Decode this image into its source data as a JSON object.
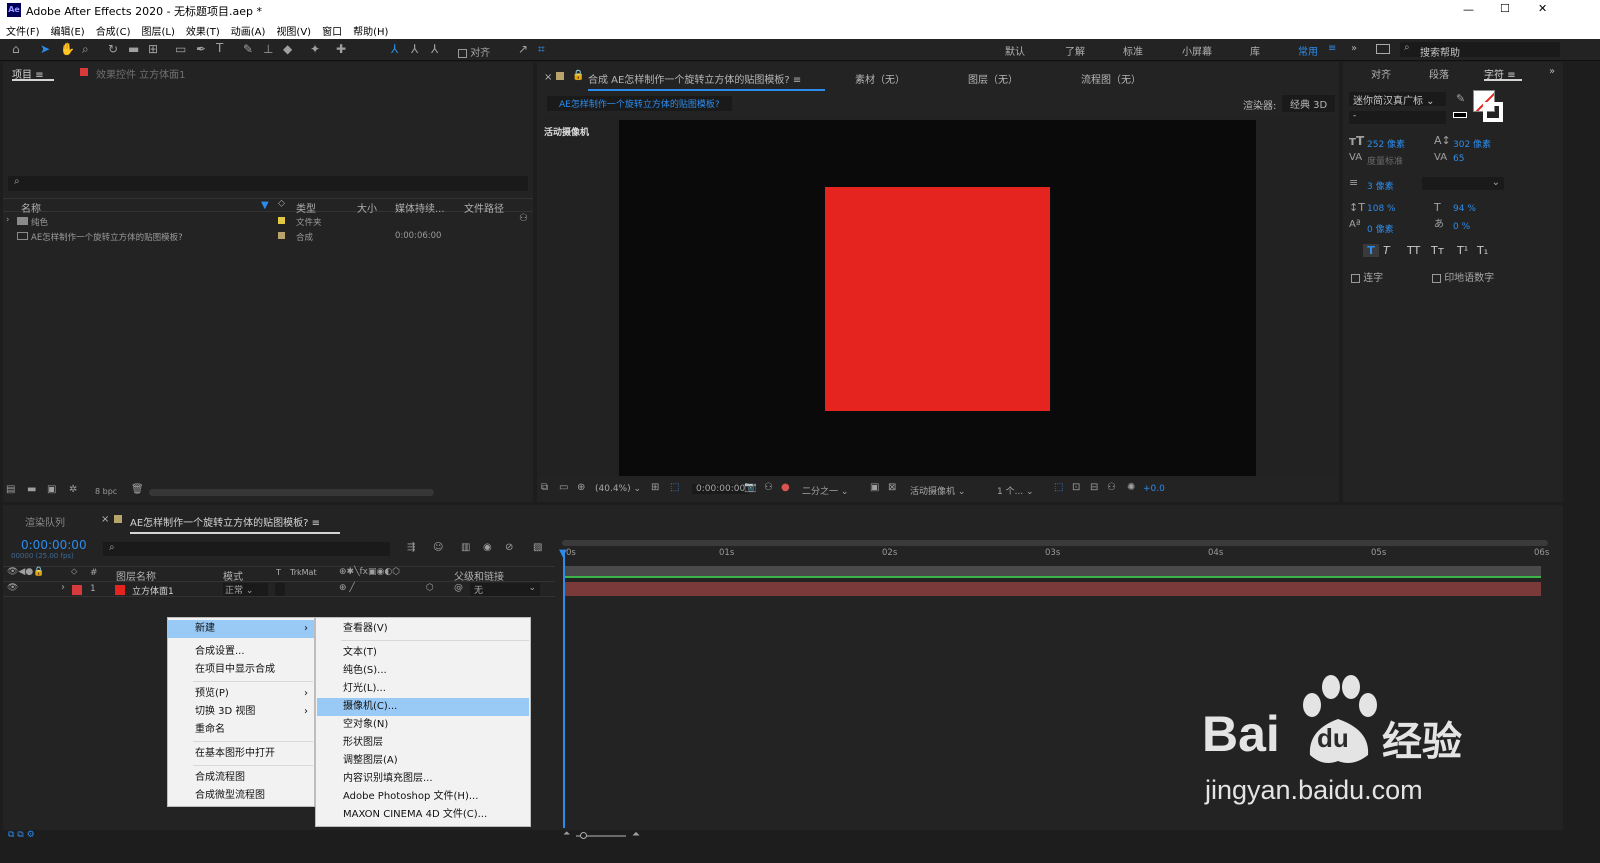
{
  "window": {
    "app_icon": "Ae",
    "title": "Adobe After Effects 2020 - 无标题项目.aep *",
    "minimize": "—",
    "maximize": "☐",
    "close": "✕"
  },
  "menu": [
    "文件(F)",
    "编辑(E)",
    "合成(C)",
    "图层(L)",
    "效果(T)",
    "动画(A)",
    "视图(V)",
    "窗口",
    "帮助(H)"
  ],
  "toolbar": {
    "align_label": "对齐",
    "workspaces": [
      "默认",
      "了解",
      "标准",
      "小屏幕",
      "库"
    ],
    "active_workspace": "常用",
    "search_placeholder": "搜索帮助"
  },
  "project_panel": {
    "tab_project": "项目",
    "tab_effects": "效果控件 立方体面1",
    "columns": [
      "名称",
      "类型",
      "大小",
      "媒体持续...",
      "文件路径"
    ],
    "items": [
      {
        "name": "纯色",
        "type": "文件夹",
        "duration": ""
      },
      {
        "name": "AE怎样制作一个旋转立方体的贴图模板?",
        "type": "合成",
        "duration": "0:00:06:00"
      }
    ],
    "bpc": "8 bpc"
  },
  "comp_panel": {
    "tab_comp": "合成 AE怎样制作一个旋转立方体的贴图模板?",
    "tab_footage": "素材（无）",
    "tab_layer": "图层（无）",
    "tab_flow": "流程图（无）",
    "breadcrumb": "AE怎样制作一个旋转立方体的贴图模板?",
    "renderer_label": "渲染器:",
    "renderer": "经典 3D",
    "camera_label": "活动摄像机",
    "zoom": "(40.4%)",
    "timecode": "0:00:00:00",
    "resolution": "二分之一",
    "view": "活动摄像机",
    "views_count": "1 个...",
    "exposure": "+0.0",
    "solid_color": "#e52420"
  },
  "character_panel": {
    "tab_align": "对齐",
    "tab_paragraph": "段落",
    "tab_character": "字符",
    "font": "迷你简汉真广标",
    "font_style": "-",
    "font_size": "252 像素",
    "leading": "302 像素",
    "kerning": "度量标准",
    "tracking": "65",
    "stroke": "3 像素",
    "vscale": "108 %",
    "hscale": "94 %",
    "baseline": "0 像素",
    "tsume": "0 %",
    "ligature_label": "连字",
    "hindi_label": "印地语数字",
    "styles": [
      "T",
      "T",
      "TT",
      "Tт",
      "T¹",
      "T₁"
    ]
  },
  "timeline": {
    "tab_render": "渲染队列",
    "tab_comp": "AE怎样制作一个旋转立方体的贴图模板?",
    "timecode": "0:00:00:00",
    "fps": "00000 (25.00 fps)",
    "col_layer_name": "图层名称",
    "col_mode": "模式",
    "col_t": "T",
    "col_trkmat": "TrkMat",
    "col_parent": "父级和链接",
    "layer": {
      "index": "1",
      "name": "立方体面1",
      "mode": "正常",
      "parent": "无"
    },
    "ruler": [
      "0s",
      "01s",
      "02s",
      "03s",
      "04s",
      "05s",
      "06s"
    ]
  },
  "context_menu": {
    "items": [
      "新建",
      "合成设置...",
      "在项目中显示合成",
      "预览(P)",
      "切换 3D 视图",
      "重命名",
      "在基本图形中打开",
      "合成流程图",
      "合成微型流程图"
    ]
  },
  "submenu": {
    "items": [
      "查看器(V)",
      "文本(T)",
      "纯色(S)...",
      "灯光(L)...",
      "摄像机(C)...",
      "空对象(N)",
      "形状图层",
      "调整图层(A)",
      "内容识别填充图层...",
      "Adobe Photoshop 文件(H)...",
      "MAXON CINEMA 4D 文件(C)..."
    ],
    "highlighted": "摄像机(C)..."
  },
  "watermark": {
    "brand": "Bai",
    "paw_text": "du",
    "cn": "经验",
    "url": "jingyan.baidu.com"
  }
}
